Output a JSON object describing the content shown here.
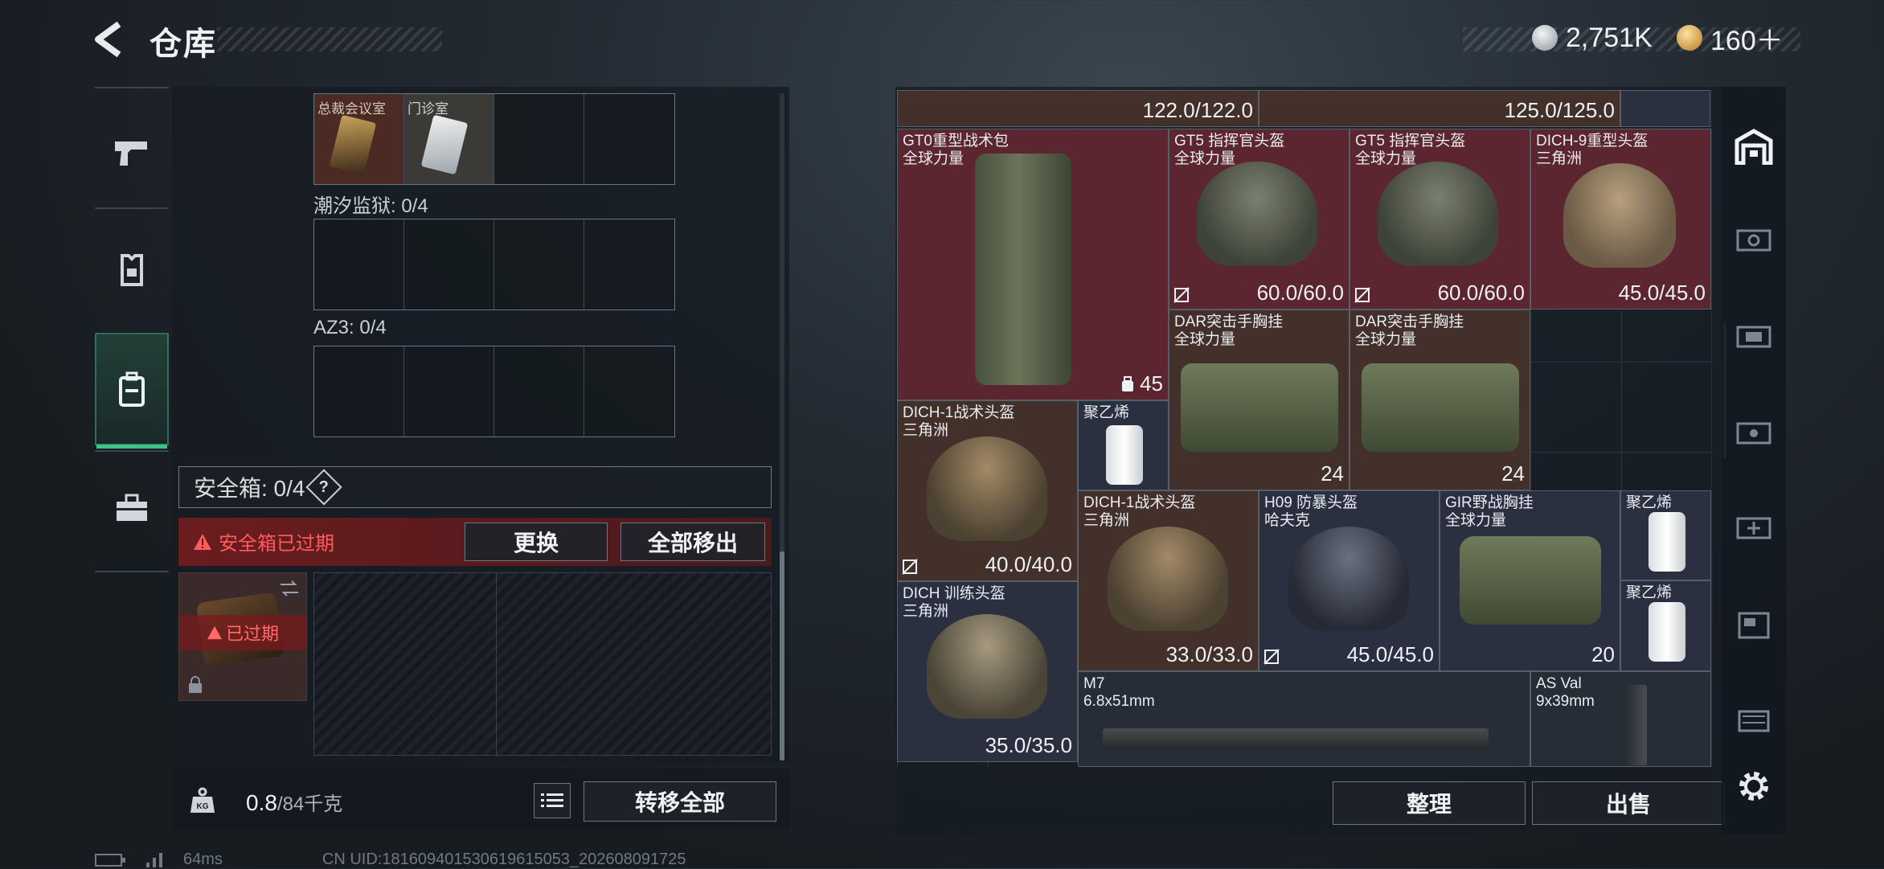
{
  "header": {
    "title": "仓库",
    "currency": [
      {
        "value": "2,751K",
        "color": "#c8cdd2"
      },
      {
        "value": "160＋",
        "color": "#e7b04a"
      }
    ]
  },
  "left_rail": {
    "items": [
      {
        "name": "weapon-icon"
      },
      {
        "name": "armor-icon"
      },
      {
        "name": "backpack-icon"
      },
      {
        "name": "toolbox-icon"
      }
    ]
  },
  "containers": [
    {
      "label": "总裁会议室",
      "label2": "门诊室"
    },
    {
      "label": "潮汐监狱: 0/4"
    },
    {
      "label": "AZ3: 0/4"
    }
  ],
  "safebox": {
    "label": "安全箱: 0/4",
    "help": "?",
    "expired_label": "安全箱已过期",
    "replace_label": "更换",
    "remove_all_label": "全部移出",
    "slot_label": "已过期"
  },
  "weight": {
    "current": "0.8",
    "max": "/84千克",
    "transfer_label": "转移全部"
  },
  "inventory": {
    "top_row": [
      {
        "value": "122.0/122.0"
      },
      {
        "value": "125.0/125.0"
      }
    ],
    "items": [
      {
        "name": "GT0重型战术包",
        "sub": "全球力量",
        "value": "45"
      },
      {
        "name": "GT5 指挥官头盔",
        "sub": "全球力量",
        "value": "60.0/60.0"
      },
      {
        "name": "GT5 指挥官头盔",
        "sub": "全球力量",
        "value": "60.0/60.0"
      },
      {
        "name": "DICH-9重型头盔",
        "sub": "三角洲",
        "value": "45.0/45.0"
      },
      {
        "name": "DAR突击手胸挂",
        "sub": "全球力量",
        "value": "24"
      },
      {
        "name": "DAR突击手胸挂",
        "sub": "全球力量",
        "value": "24"
      },
      {
        "name": "DICH-1战术头盔",
        "sub": "三角洲",
        "value": "40.0/40.0"
      },
      {
        "name": "聚乙烯",
        "sub": "",
        "value": ""
      },
      {
        "name": "DICH-1战术头盔",
        "sub": "三角洲",
        "value": "33.0/33.0"
      },
      {
        "name": "H09 防暴头盔",
        "sub": "哈夫克",
        "value": "45.0/45.0"
      },
      {
        "name": "GIR野战胸挂",
        "sub": "全球力量",
        "value": "20"
      },
      {
        "name": "聚乙烯",
        "sub": "",
        "value": ""
      },
      {
        "name": "聚乙烯",
        "sub": "",
        "value": ""
      },
      {
        "name": "DICH 训练头盔",
        "sub": "三角洲",
        "value": "35.0/35.0"
      },
      {
        "name": "M7",
        "sub": "6.8x51mm",
        "value": ""
      },
      {
        "name": "AS Val",
        "sub": "9x39mm",
        "value": ""
      }
    ],
    "sort_label": "整理",
    "sell_label": "出售"
  },
  "footer": {
    "ping": "64ms",
    "uid": "CN UID:181609401530619615053_202608091725"
  }
}
